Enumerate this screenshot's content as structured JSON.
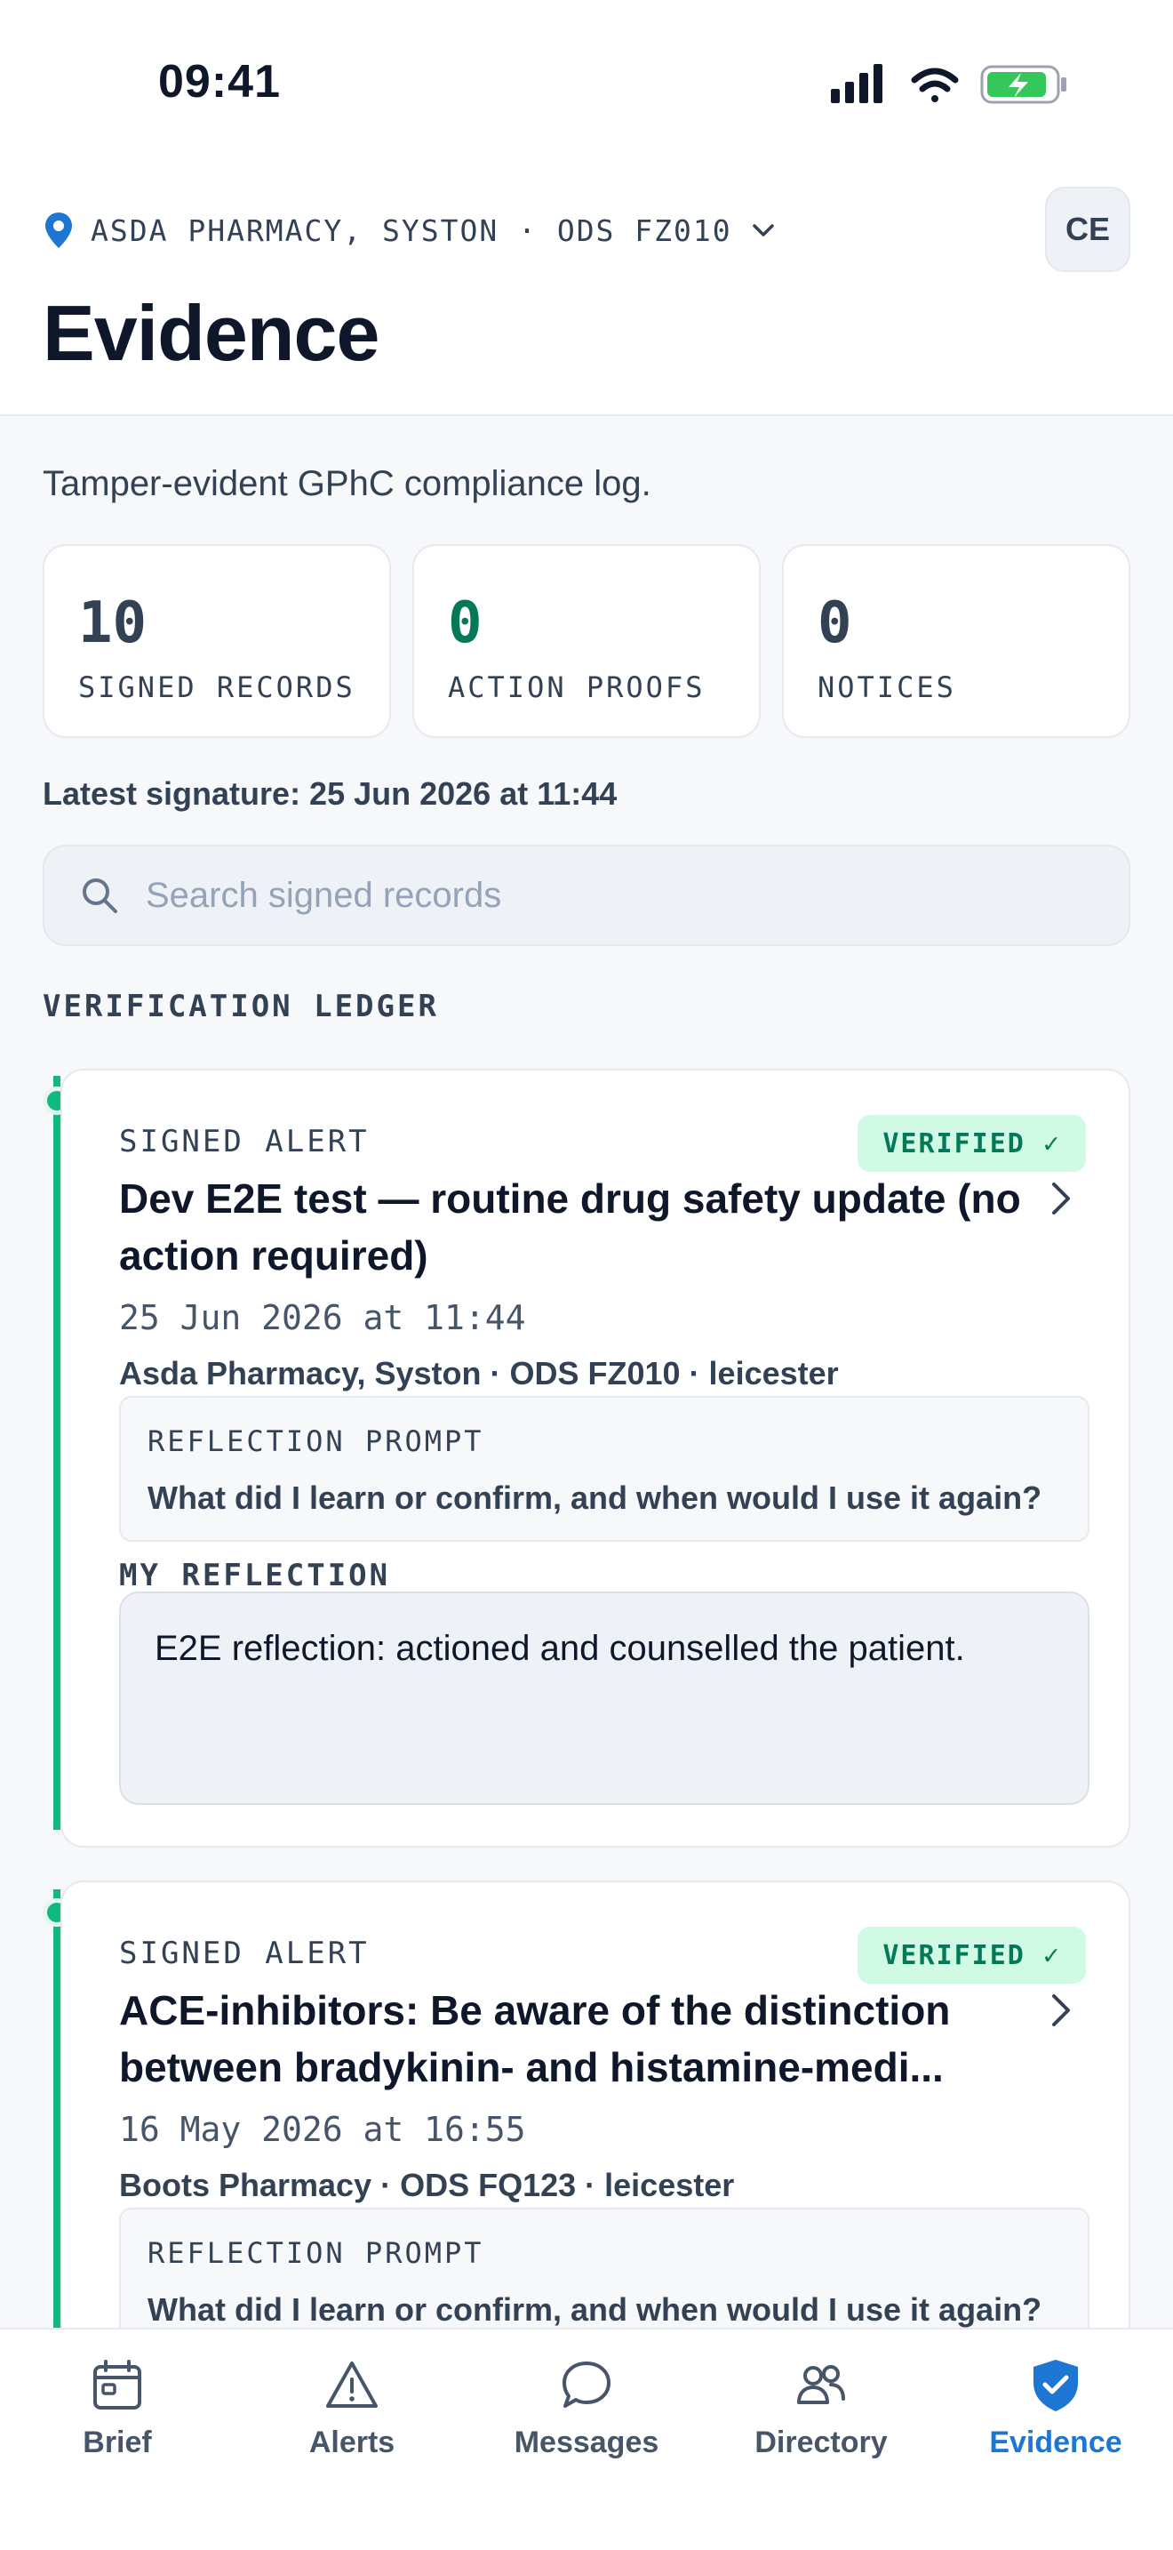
{
  "status_bar": {
    "time": "09:41"
  },
  "header": {
    "location": "ASDA PHARMACY, SYSTON · ODS FZ010",
    "avatar_initials": "CE",
    "title": "Evidence"
  },
  "subtitle": "Tamper-evident GPhC compliance log.",
  "stats": [
    {
      "value": "10",
      "label": "SIGNED RECORDS",
      "color": "#334155"
    },
    {
      "value": "0",
      "label": "ACTION PROOFS",
      "color": "#047857"
    },
    {
      "value": "0",
      "label": "NOTICES",
      "color": "#334155"
    }
  ],
  "latest_signature": "Latest signature: 25 Jun 2026 at 11:44",
  "search": {
    "placeholder": "Search signed records",
    "value": ""
  },
  "ledger": {
    "section_label": "VERIFICATION LEDGER",
    "records": [
      {
        "kind": "SIGNED ALERT",
        "badge": "VERIFIED ✓",
        "title": "Dev E2E test — routine drug safety update (no action required)",
        "date": "25 Jun 2026 at 11:44",
        "location": "Asda Pharmacy, Syston · ODS FZ010 · leicester",
        "prompt_label": "REFLECTION PROMPT",
        "prompt": "What did I learn or confirm, and when would I use it again?",
        "reflection_label": "MY REFLECTION",
        "reflection": "E2E reflection: actioned and counselled the patient."
      },
      {
        "kind": "SIGNED ALERT",
        "badge": "VERIFIED ✓",
        "title": "ACE-inhibitors: Be aware of the distinction between bradykinin- and histamine-medi...",
        "date": "16 May 2026 at 16:55",
        "location": "Boots Pharmacy · ODS FQ123 · leicester",
        "prompt_label": "REFLECTION PROMPT",
        "prompt": "What did I learn or confirm, and when would I use it again?"
      }
    ]
  },
  "tabs": [
    {
      "label": "Brief",
      "icon": "calendar-icon",
      "active": false
    },
    {
      "label": "Alerts",
      "icon": "warning-icon",
      "active": false
    },
    {
      "label": "Messages",
      "icon": "chat-bubble-icon",
      "active": false
    },
    {
      "label": "Directory",
      "icon": "people-icon",
      "active": false
    },
    {
      "label": "Evidence",
      "icon": "shield-check-icon",
      "active": true
    }
  ],
  "colors": {
    "accent": "#1d76d2",
    "verified_bg": "#d1fae5",
    "verified_text": "#047857",
    "timeline": "#10b981"
  }
}
